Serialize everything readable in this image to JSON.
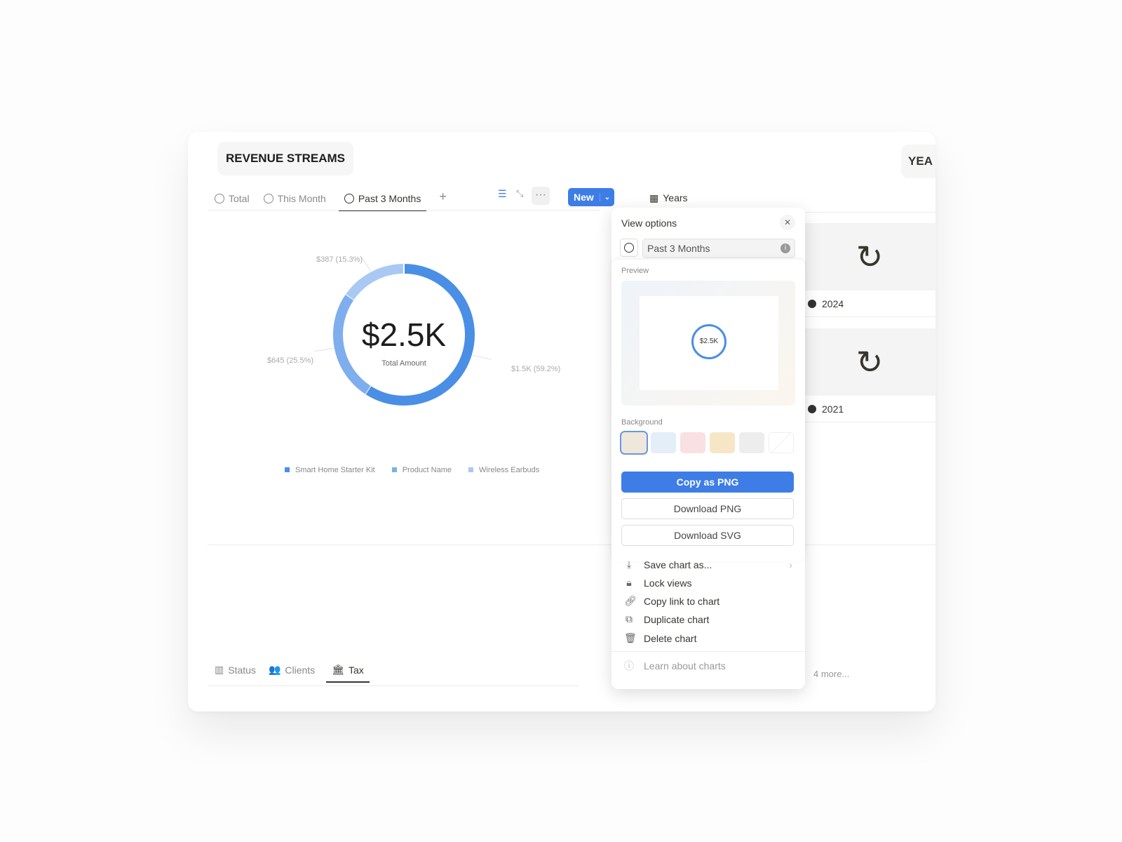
{
  "header": {
    "title": "REVENUE STREAMS",
    "right_title": "YEA"
  },
  "tabs": [
    {
      "label": "Total",
      "icon": "pie-clock-icon"
    },
    {
      "label": "This Month",
      "icon": "pie-clock-icon"
    },
    {
      "label": "Past 3 Months",
      "icon": "pie-clock-icon",
      "active": true
    }
  ],
  "toolbar": {
    "new_label": "New",
    "add": "+",
    "more": "···"
  },
  "years_view": {
    "label": "Years",
    "items": [
      "2024",
      "2021"
    ],
    "more": "4 more..."
  },
  "chart_data": {
    "type": "pie",
    "donut": true,
    "center_value": "$2.5K",
    "center_label": "Total Amount",
    "slices": [
      {
        "name": "Smart Home Starter Kit",
        "value": 1500,
        "label": "$1.5K (59.2%)",
        "percent": 59.2,
        "color": "#4a8fe5"
      },
      {
        "name": "Product Name",
        "value": 645,
        "label": "$645 (25.5%)",
        "percent": 25.5,
        "color": "#7eaeee"
      },
      {
        "name": "Wireless Earbuds",
        "value": 387,
        "label": "$387 (15.3%)",
        "percent": 15.3,
        "color": "#a9c9f4"
      }
    ],
    "legend_position": "bottom"
  },
  "bottom_tabs": [
    {
      "label": "Status"
    },
    {
      "label": "Clients"
    },
    {
      "label": "Tax",
      "active": true
    }
  ],
  "view_options": {
    "title": "View options",
    "view_name": "Past 3 Months",
    "preview_label": "Preview",
    "preview_value": "$2.5K",
    "background_label": "Background",
    "background_colors": [
      "#efe6dc",
      "#e3eef8",
      "#f9e0e2",
      "#f7e6c6",
      "#ededed",
      "none"
    ],
    "copy_png": "Copy as PNG",
    "download_png": "Download PNG",
    "download_svg": "Download SVG"
  },
  "menu": {
    "items": [
      {
        "label": "Save chart as...",
        "icon": "download-icon"
      },
      {
        "label": "Lock views",
        "icon": "lock-icon"
      },
      {
        "label": "Copy link to chart",
        "icon": "link-icon"
      },
      {
        "label": "Duplicate chart",
        "icon": "duplicate-icon"
      },
      {
        "label": "Delete chart",
        "icon": "trash-icon"
      }
    ],
    "learn": "Learn about charts"
  },
  "colors": {
    "accent": "#3e7de6"
  }
}
